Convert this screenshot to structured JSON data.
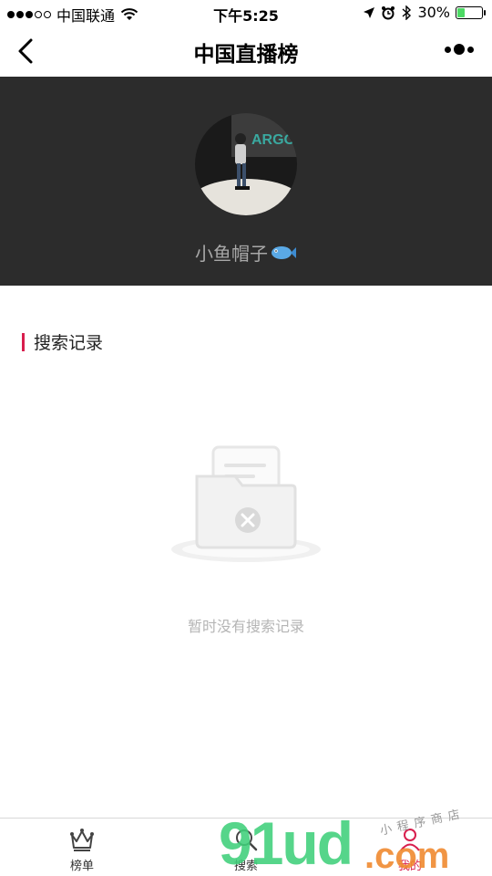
{
  "status_bar": {
    "carrier": "中国联通",
    "time": "下午5:25",
    "battery_percent": "30%"
  },
  "nav": {
    "title": "中国直播榜"
  },
  "profile": {
    "username": "小鱼帽子",
    "avatar_text": "ARGO"
  },
  "section": {
    "title": "搜索记录"
  },
  "empty_state": {
    "message": "暂时没有搜索记录"
  },
  "tabbar": {
    "tabs": [
      {
        "label": "榜单",
        "icon": "crown-icon"
      },
      {
        "label": "搜索",
        "icon": "search-icon"
      },
      {
        "label": "我的",
        "icon": "user-icon"
      }
    ]
  },
  "watermark": {
    "main": "91ud",
    "suffix": ".com",
    "sub": "小程序商店"
  },
  "colors": {
    "accent": "#d81e4d",
    "header_bg": "#2c2c2c",
    "muted_text": "#b5b5b5",
    "battery": "#4cd964"
  }
}
